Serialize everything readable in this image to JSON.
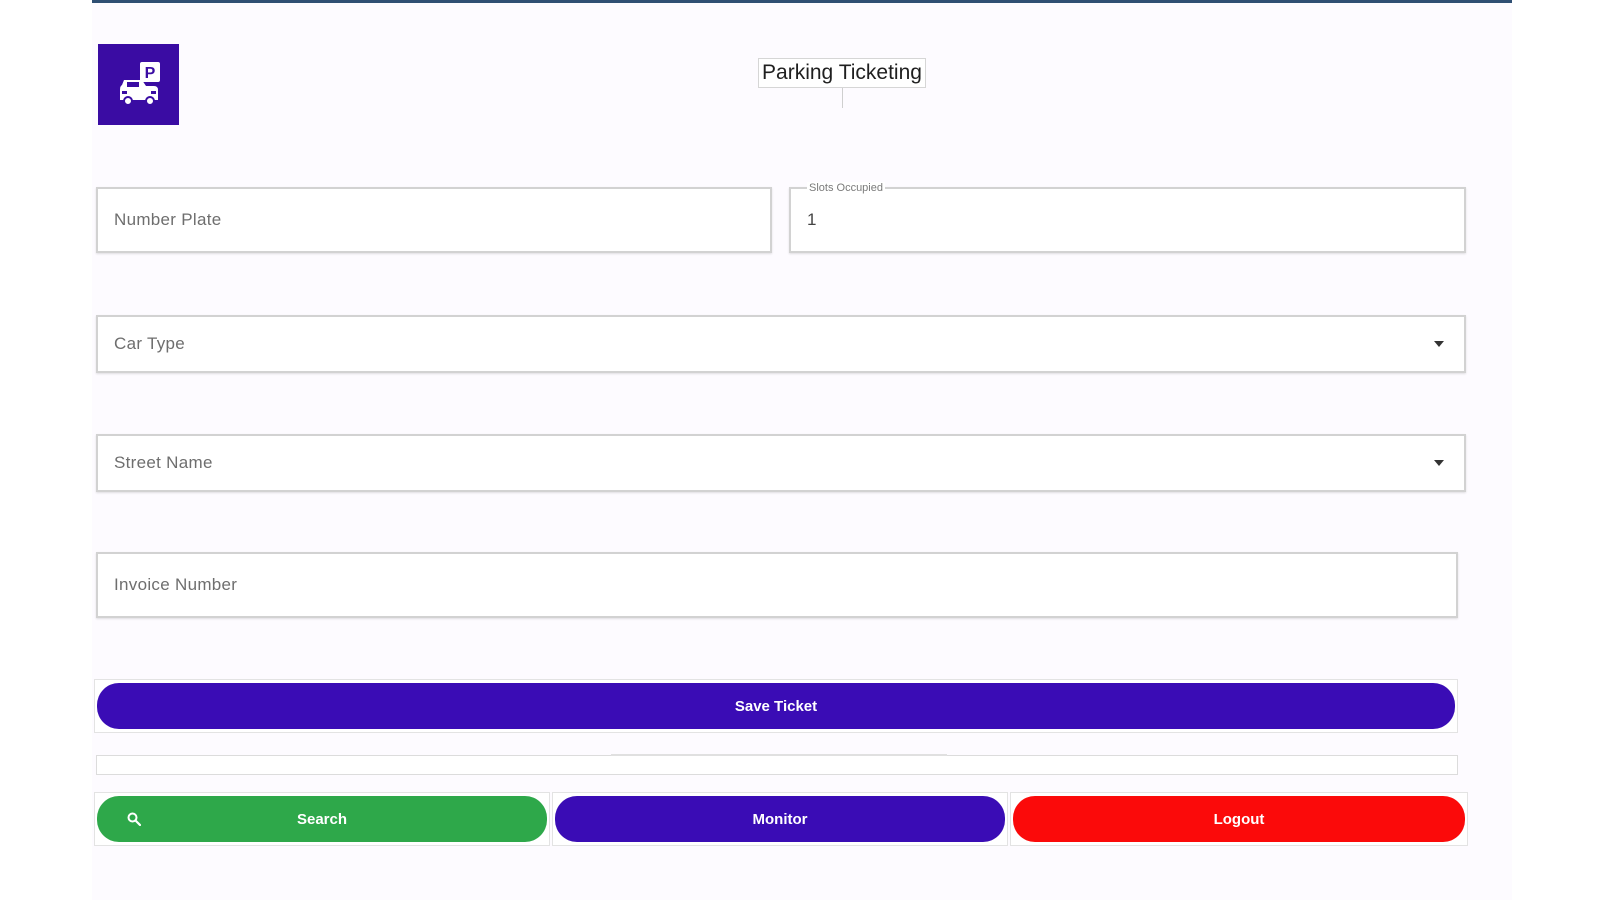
{
  "app": {
    "title": "Parking Ticketing",
    "logo_icon": "car-parking-icon",
    "accent_color": "#3a0cb5"
  },
  "form": {
    "number_plate": {
      "placeholder": "Number Plate",
      "value": ""
    },
    "slots_occupied": {
      "label": "Slots Occupied",
      "value": "1"
    },
    "car_type": {
      "placeholder": "Car Type",
      "selected": ""
    },
    "street_name": {
      "placeholder": "Street Name",
      "selected": ""
    },
    "invoice_number": {
      "placeholder": "Invoice Number",
      "value": ""
    }
  },
  "actions": {
    "save_label": "Save Ticket",
    "search_label": "Search",
    "search_icon": "search-icon",
    "monitor_label": "Monitor",
    "logout_label": "Logout"
  },
  "colors": {
    "search": "#2ea84a",
    "monitor": "#3a0cb5",
    "logout": "#fb0a0a"
  }
}
